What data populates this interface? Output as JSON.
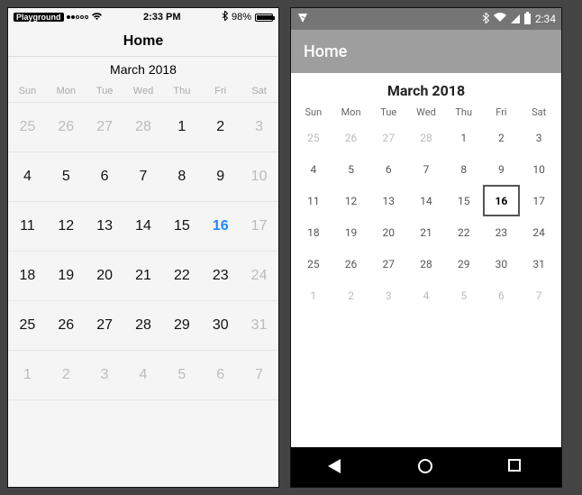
{
  "ios": {
    "status": {
      "carrier": "Playground",
      "time": "2:33 PM",
      "battery_pct": "98%"
    },
    "title": "Home",
    "month_label": "March 2018",
    "dow": [
      "Sun",
      "Mon",
      "Tue",
      "Wed",
      "Thu",
      "Fri",
      "Sat"
    ],
    "weeks": [
      [
        {
          "n": "25",
          "trail": true
        },
        {
          "n": "26",
          "trail": true
        },
        {
          "n": "27",
          "trail": true
        },
        {
          "n": "28",
          "trail": true
        },
        {
          "n": "1"
        },
        {
          "n": "2"
        },
        {
          "n": "3",
          "trail": true
        }
      ],
      [
        {
          "n": "4"
        },
        {
          "n": "5"
        },
        {
          "n": "6"
        },
        {
          "n": "7"
        },
        {
          "n": "8"
        },
        {
          "n": "9"
        },
        {
          "n": "10",
          "trail": true
        }
      ],
      [
        {
          "n": "11"
        },
        {
          "n": "12"
        },
        {
          "n": "13"
        },
        {
          "n": "14"
        },
        {
          "n": "15"
        },
        {
          "n": "16",
          "selected": true
        },
        {
          "n": "17",
          "trail": true
        }
      ],
      [
        {
          "n": "18"
        },
        {
          "n": "19"
        },
        {
          "n": "20"
        },
        {
          "n": "21"
        },
        {
          "n": "22"
        },
        {
          "n": "23"
        },
        {
          "n": "24",
          "trail": true
        }
      ],
      [
        {
          "n": "25"
        },
        {
          "n": "26"
        },
        {
          "n": "27"
        },
        {
          "n": "28"
        },
        {
          "n": "29"
        },
        {
          "n": "30"
        },
        {
          "n": "31",
          "trail": true
        }
      ],
      [
        {
          "n": "1",
          "trail": true
        },
        {
          "n": "2",
          "trail": true
        },
        {
          "n": "3",
          "trail": true
        },
        {
          "n": "4",
          "trail": true
        },
        {
          "n": "5",
          "trail": true
        },
        {
          "n": "6",
          "trail": true
        },
        {
          "n": "7",
          "trail": true
        }
      ]
    ]
  },
  "android": {
    "status": {
      "time": "2:34"
    },
    "title": "Home",
    "month_label": "March 2018",
    "dow": [
      "Sun",
      "Mon",
      "Tue",
      "Wed",
      "Thu",
      "Fri",
      "Sat"
    ],
    "weeks": [
      [
        {
          "n": "25",
          "trail": true
        },
        {
          "n": "26",
          "trail": true
        },
        {
          "n": "27",
          "trail": true
        },
        {
          "n": "28",
          "trail": true
        },
        {
          "n": "1"
        },
        {
          "n": "2"
        },
        {
          "n": "3"
        }
      ],
      [
        {
          "n": "4"
        },
        {
          "n": "5"
        },
        {
          "n": "6"
        },
        {
          "n": "7"
        },
        {
          "n": "8"
        },
        {
          "n": "9"
        },
        {
          "n": "10"
        }
      ],
      [
        {
          "n": "11"
        },
        {
          "n": "12"
        },
        {
          "n": "13"
        },
        {
          "n": "14"
        },
        {
          "n": "15"
        },
        {
          "n": "16",
          "selected": true
        },
        {
          "n": "17"
        }
      ],
      [
        {
          "n": "18"
        },
        {
          "n": "19"
        },
        {
          "n": "20"
        },
        {
          "n": "21"
        },
        {
          "n": "22"
        },
        {
          "n": "23"
        },
        {
          "n": "24"
        }
      ],
      [
        {
          "n": "25"
        },
        {
          "n": "26"
        },
        {
          "n": "27"
        },
        {
          "n": "28"
        },
        {
          "n": "29"
        },
        {
          "n": "30"
        },
        {
          "n": "31"
        }
      ],
      [
        {
          "n": "1",
          "trail": true
        },
        {
          "n": "2",
          "trail": true
        },
        {
          "n": "3",
          "trail": true
        },
        {
          "n": "4",
          "trail": true
        },
        {
          "n": "5",
          "trail": true
        },
        {
          "n": "6",
          "trail": true
        },
        {
          "n": "7",
          "trail": true
        }
      ]
    ]
  }
}
